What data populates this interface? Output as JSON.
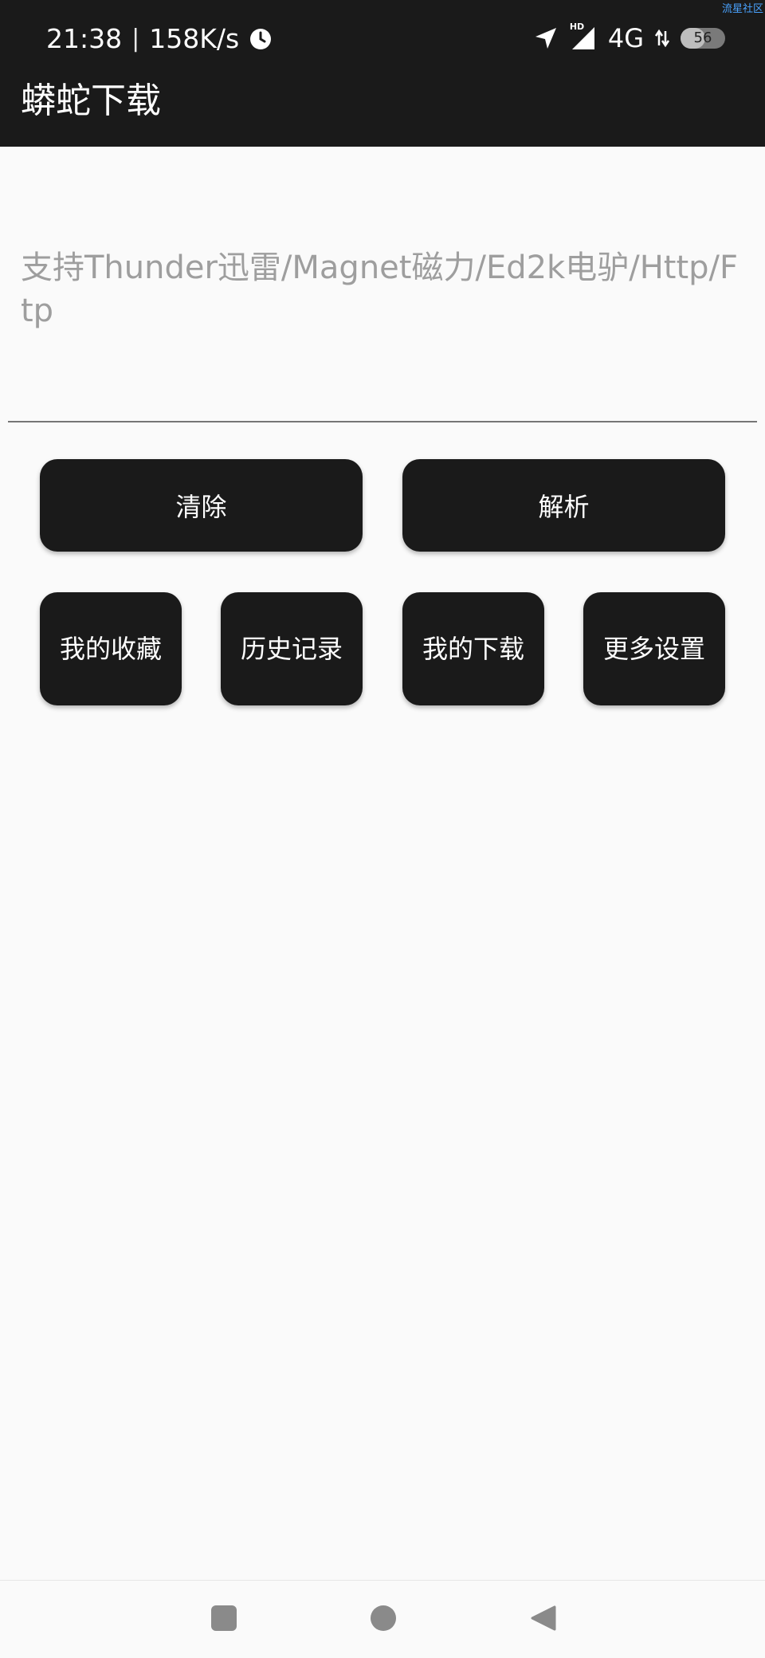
{
  "status_bar": {
    "time": "21:38",
    "separator": "|",
    "net_speed": "158K/s",
    "network_type": "4G",
    "hd_label": "HD",
    "battery_level": "56",
    "battery_fraction": 0.56,
    "watermark": "流星社区",
    "icons": [
      "clock-icon",
      "location-arrow-icon",
      "signal-icon",
      "data-arrows-icon",
      "battery-icon"
    ]
  },
  "toolbar": {
    "title": "蟒蛇下载"
  },
  "url_input": {
    "placeholder": "支持Thunder迅雷/Magnet磁力/Ed2k电驴/Http/Ftp",
    "value": ""
  },
  "actions": {
    "clear_label": "清除",
    "parse_label": "解析",
    "favorites_label": "我的收藏",
    "history_label": "历史记录",
    "downloads_label": "我的下载",
    "settings_label": "更多设置"
  },
  "nav_bar": {
    "icons": [
      "recent-apps-icon",
      "home-icon",
      "back-icon"
    ]
  },
  "colors": {
    "bar_background": "#1a1a1a",
    "page_background": "#fafafa",
    "button_background": "#1a1a1a",
    "button_text": "#ffffff",
    "placeholder_text": "#9e9e9e"
  }
}
